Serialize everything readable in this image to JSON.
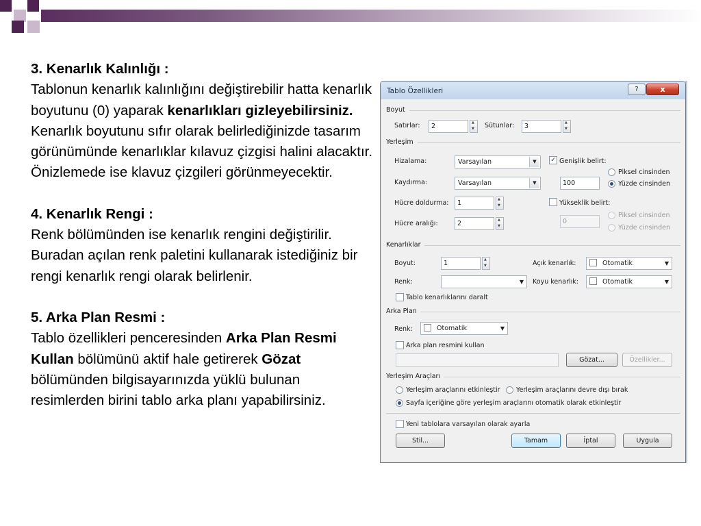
{
  "slide": {
    "p1_heading": "3. Kenarlık Kalınlığı :",
    "p1_a": "Tablonun kenarlık kalınlığını değiştirebilir hatta kenarlık boyutunu (0) yaparak ",
    "p1_bold": "kenarlıkları gizleyebilirsiniz.",
    "p1_b": " Kenarlık boyutunu sıfır olarak belirlediğinizde tasarım görünümünde kenarlıklar kılavuz çizgisi halini alacaktır. Önizlemede ise klavuz çizgileri görünmeyecektir.",
    "p2_heading": "4. Kenarlık Rengi :",
    "p2_text": "Renk bölümünden ise kenarlık rengini değiştirilir. Buradan açılan renk paletini kullanarak istediğiniz bir rengi kenarlık rengi olarak belirlenir.",
    "p3_heading": "5. Arka Plan Resmi :",
    "p3_a": "Tablo özellikleri penceresinden ",
    "p3_bold1": "Arka Plan Resmi Kullan",
    "p3_b": " bölümünü aktif hale getirerek ",
    "p3_bold2": "Gözat",
    "p3_c": " bölümünden bilgisayarınızda yüklü bulunan resimlerden birini tablo arka planı yapabilirsiniz."
  },
  "dialog": {
    "title": "Tablo Özellikleri",
    "help_label": "?",
    "close_label": "x",
    "size": {
      "section": "Boyut",
      "rows_label": "Satırlar:",
      "rows_value": "2",
      "cols_label": "Sütunlar:",
      "cols_value": "3"
    },
    "layout": {
      "section": "Yerleşim",
      "align_label": "Hizalama:",
      "align_value": "Varsayılan",
      "width_check_label": "Genişlik belirt:",
      "width_checked": "✓",
      "wrap_label": "Kaydırma:",
      "wrap_value": "Varsayılan",
      "width_value": "100",
      "width_px_label": "Piksel cinsinden",
      "width_pct_label": "Yüzde cinsinden",
      "padding_label": "Hücre doldurma:",
      "padding_value": "1",
      "height_check_label": "Yükseklik belirt:",
      "spacing_label": "Hücre aralığı:",
      "spacing_value": "2",
      "height_value": "0",
      "height_px_label": "Piksel cinsinden",
      "height_pct_label": "Yüzde cinsinden"
    },
    "borders": {
      "section": "Kenarlıklar",
      "size_label": "Boyut:",
      "size_value": "1",
      "color_label": "Renk:",
      "light_label": "Açık kenarlık:",
      "light_value": "Otomatik",
      "dark_label": "Koyu kenarlık:",
      "dark_value": "Otomatik",
      "collapse_label": "Tablo kenarlıklarını daralt"
    },
    "background": {
      "section": "Arka Plan",
      "color_label": "Renk:",
      "color_value": "Otomatik",
      "image_check_label": "Arka plan resmini kullan",
      "image_path": "",
      "browse_label": "Gözat...",
      "props_label": "Özellikler..."
    },
    "layout_tools": {
      "section": "Yerleşim Araçları",
      "enable_label": "Yerleşim araçlarını etkinleştir",
      "disable_label": "Yerleşim araçlarını devre dışı bırak",
      "auto_label": "Sayfa içeriğine göre yerleşim araçlarını otomatik olarak etkinleştir"
    },
    "default_check_label": "Yeni tablolara varsayılan olarak ayarla",
    "buttons": {
      "style": "Stil...",
      "ok": "Tamam",
      "cancel": "İptal",
      "apply": "Uygula"
    }
  }
}
